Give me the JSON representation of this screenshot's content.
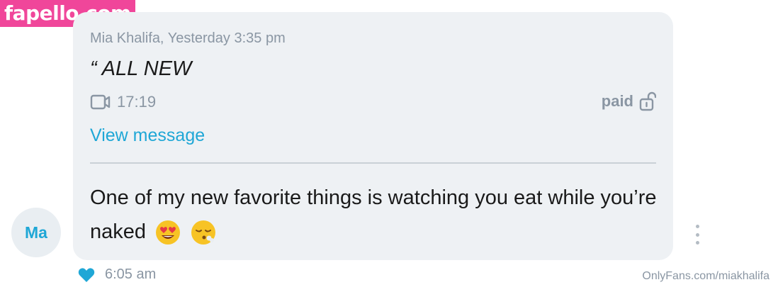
{
  "watermark": {
    "text": "fapello.com"
  },
  "avatar": {
    "initials": "Ma"
  },
  "message": {
    "meta": "Mia Khalifa, Yesterday 3:35 pm",
    "quote": "“ ALL NEW",
    "media": {
      "icon": "video-camera-icon",
      "duration": "17:19"
    },
    "paid_label": "paid",
    "paid_icon": "unlock-icon",
    "view_link": "View message",
    "body": "One of my new favorite things is watching you eat while you’re naked",
    "emojis": [
      "heart-eyes-emoji",
      "face-exhaling-emoji"
    ]
  },
  "footer": {
    "time": "6:05 am",
    "like_icon": "heart-icon",
    "like_color": "#1fa7d6",
    "attribution": "OnlyFans.com/miakhalifa"
  },
  "colors": {
    "accent": "#1fa7d6",
    "bubble": "#eef1f4",
    "watermark_bg": "#f0469a"
  }
}
